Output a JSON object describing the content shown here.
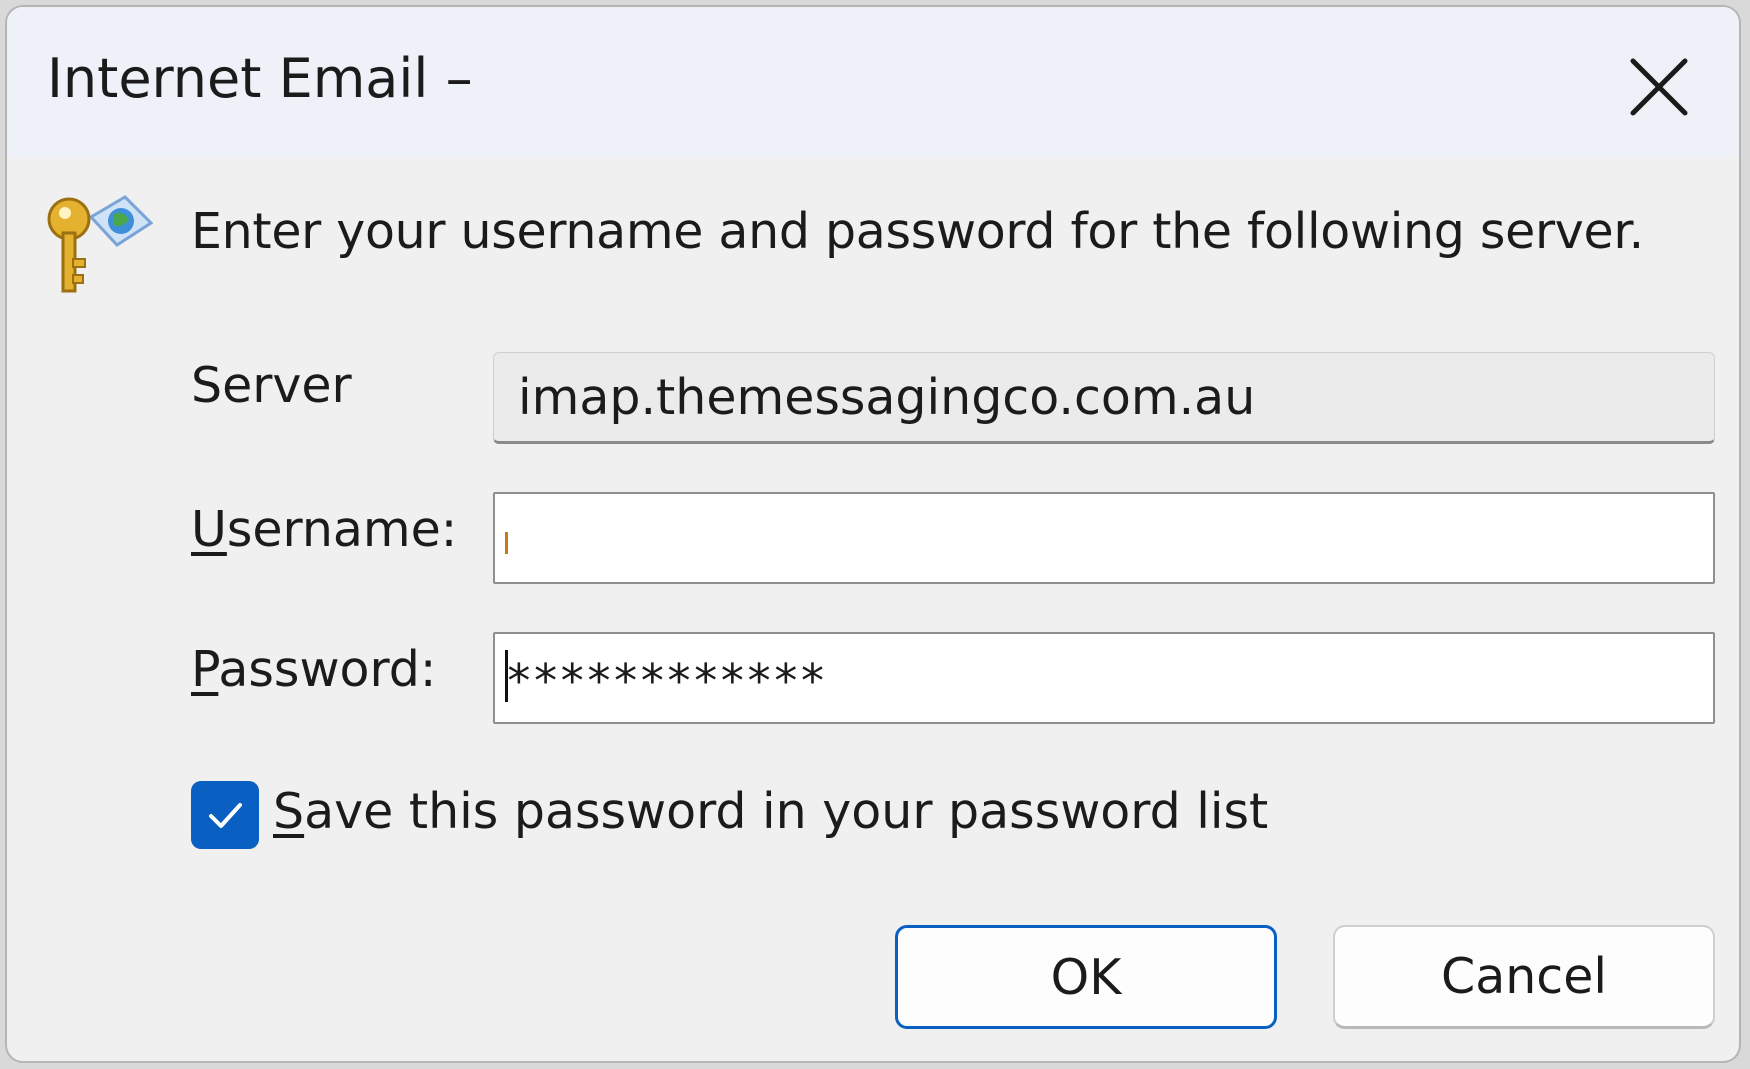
{
  "window": {
    "title": "Internet Email – ",
    "close_icon": "close-icon"
  },
  "dialog": {
    "icon": "key-globe-icon",
    "prompt": "Enter your username and password for the following server.",
    "server_label": "Server",
    "server_value": "imap.themessagingco.com.au",
    "username_label_accel": "U",
    "username_label_rest": "sername:",
    "username_value": "",
    "password_label_accel": "P",
    "password_label_rest": "assword:",
    "password_value": "************",
    "save_checked": true,
    "save_label_accel": "S",
    "save_label_rest": "ave this password in your password list",
    "ok_label": "OK",
    "cancel_label": "Cancel"
  },
  "colors": {
    "accent": "#0a5fc2",
    "titlebar": "#eef2f8",
    "window_bg": "#f0f0f0"
  }
}
